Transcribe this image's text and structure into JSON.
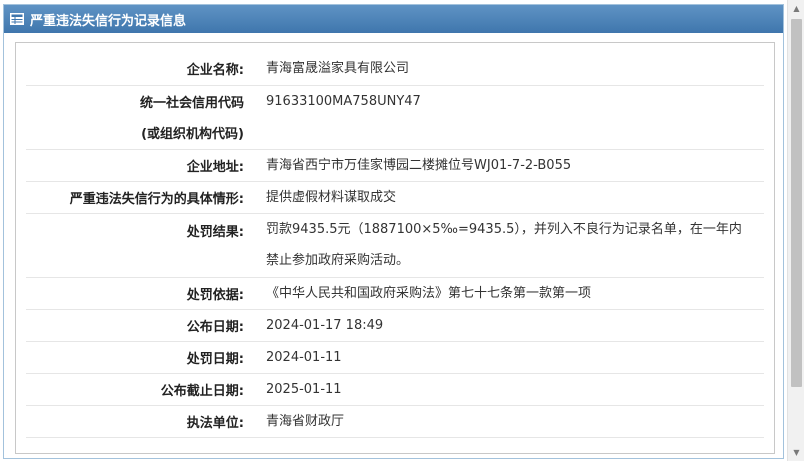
{
  "panel": {
    "title": "严重违法失信行为记录信息",
    "icon": "table-icon"
  },
  "records": [
    {
      "label": "企业名称:",
      "value": "青海富晟溢家具有限公司"
    },
    {
      "label": "统一社会信用代码",
      "label2": "(或组织机构代码)",
      "value": "91633100MA758UNY47"
    },
    {
      "label": "企业地址:",
      "value": "青海省西宁市万佳家博园二楼摊位号WJ01-7-2-B055"
    },
    {
      "label": "严重违法失信行为的具体情形:",
      "value": "提供虚假材料谋取成交"
    },
    {
      "label": "处罚结果:",
      "value_line1": "罚款9435.5元（1887100×5‰=9435.5），并列入不良行为记录名单，在一年内",
      "value_line2": "禁止参加政府采购活动。"
    },
    {
      "label": "处罚依据:",
      "value": "《中华人民共和国政府采购法》第七十七条第一款第一项"
    },
    {
      "label": "公布日期:",
      "value": "2024-01-17 18:49"
    },
    {
      "label": "处罚日期:",
      "value": "2024-01-11"
    },
    {
      "label": "公布截止日期:",
      "value": "2025-01-11"
    },
    {
      "label": "执法单位:",
      "value": "青海省财政厅"
    }
  ],
  "colors": {
    "header_bg": "#4a80b8",
    "border": "#a3c2dc"
  }
}
